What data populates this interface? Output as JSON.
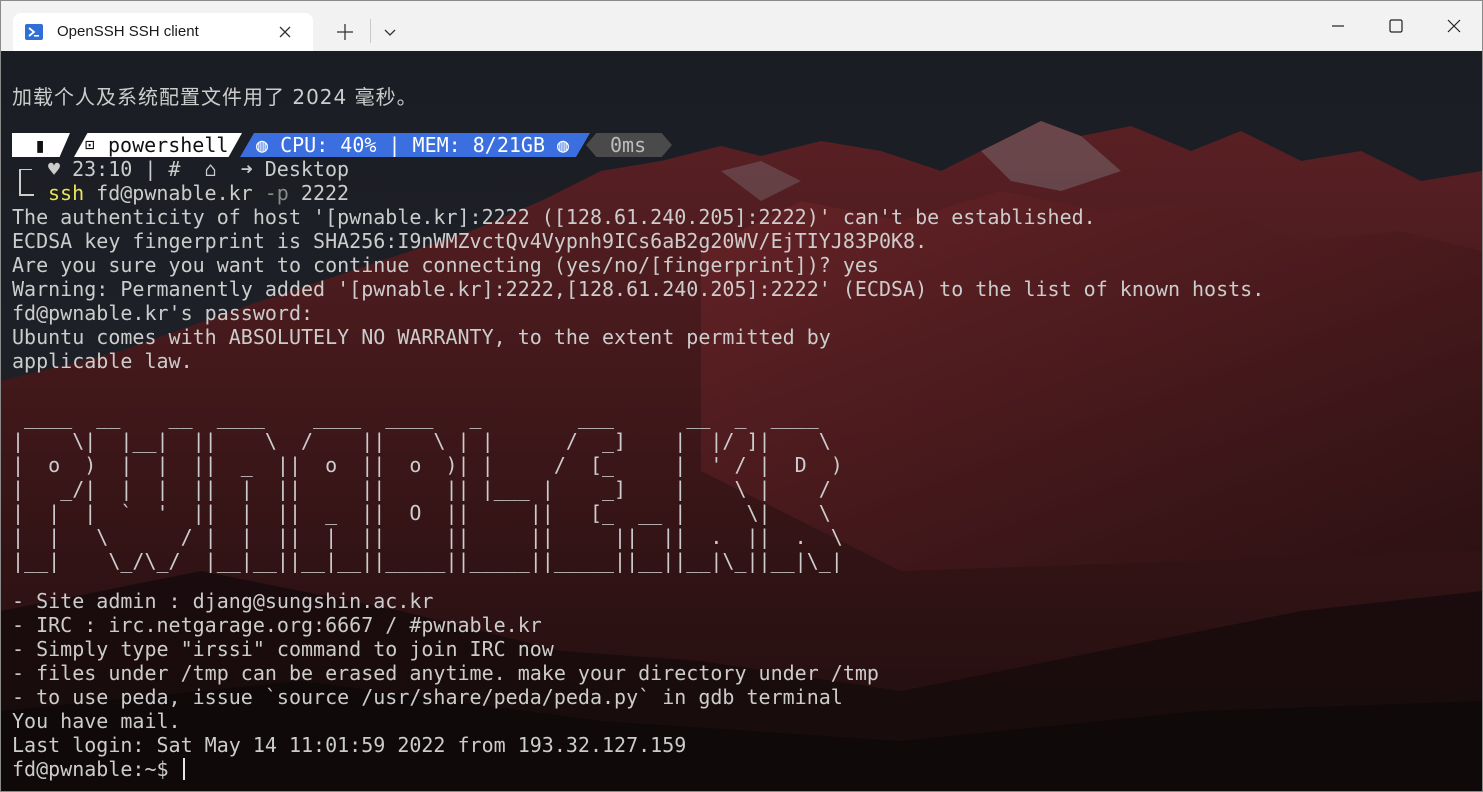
{
  "window": {
    "tab_title": "OpenSSH SSH client",
    "tab_icon": "powershell-icon",
    "controls": [
      "close-icon",
      "plus-icon",
      "chevron-down-icon",
      "minimize-icon",
      "maximize-icon",
      "close-window-icon"
    ]
  },
  "terminal": {
    "profile_load_msg": "加载个人及系统配置文件用了 2024 毫秒。",
    "prompt": {
      "os_glyph": "▮",
      "shell_glyph": "⊡",
      "shell_label": "powershell",
      "sys_label": "◍ CPU: 40% | MEM: 8/21GB ◍",
      "time_label": "0ms",
      "line2": "♥ 23:10 | #  ⌂  ➜ Desktop",
      "cmd_name": "ssh",
      "cmd_host": "fd@pwnable.kr",
      "cmd_flag": "-p",
      "cmd_port": "2222"
    },
    "output_lines": [
      "The authenticity of host '[pwnable.kr]:2222 ([128.61.240.205]:2222)' can't be established.",
      "ECDSA key fingerprint is SHA256:I9nWMZvctQv4Vypnh9ICs6aB2g20WV/EjTIYJ83P0K8.",
      "Are you sure you want to continue connecting (yes/no/[fingerprint])? yes",
      "Warning: Permanently added '[pwnable.kr]:2222,[128.61.240.205]:2222' (ECDSA) to the list of known hosts.",
      "fd@pwnable.kr's password:",
      "Ubuntu comes with ABSOLUTELY NO WARRANTY, to the extent permitted by",
      "applicable law."
    ],
    "banner_lines": [
      " ____  __    __  ____    ____  ____   _        ___      __  _  ____ ",
      "|    \\|  |__|  ||    \\  /    ||    \\ | |      /  _]    |  |/ ]|    \\ ",
      "|  o  )  |  |  ||  _  ||  o  ||  o  )| |     /  [_     |  ' / |  D  )",
      "|   _/|  |  |  ||  |  ||     ||     || |___ |    _]    |    \\ |    / ",
      "|  |  |  `  '  ||  |  ||  _  ||  O  ||     ||   [_  __ |     \\|    \\ ",
      "|  |   \\      / |  |  ||  |  ||     ||     ||     ||  ||  .  ||  .  \\",
      "|__|    \\_/\\_/  |__|__||__|__||_____||_____||_____||__||__|\\_||__|\\_|"
    ],
    "info_lines": [
      "- Site admin : djang@sungshin.ac.kr",
      "- IRC : irc.netgarage.org:6667 / #pwnable.kr",
      "- Simply type \"irssi\" command to join IRC now",
      "- files under /tmp can be erased anytime. make your directory under /tmp",
      "- to use peda, issue `source /usr/share/peda/peda.py` in gdb terminal",
      "You have mail.",
      "Last login: Sat May 14 11:01:59 2022 from 193.32.127.159"
    ],
    "shell_prompt": "fd@pwnable:~$ "
  },
  "colors": {
    "titlebar": "#f2f2f2",
    "tab_active": "#ffffff",
    "terminal_text": "#cccccc",
    "prompt_blue": "#3b6fe0",
    "prompt_gray": "#4a4a4a",
    "ssh_yellow": "#e8e35a"
  }
}
